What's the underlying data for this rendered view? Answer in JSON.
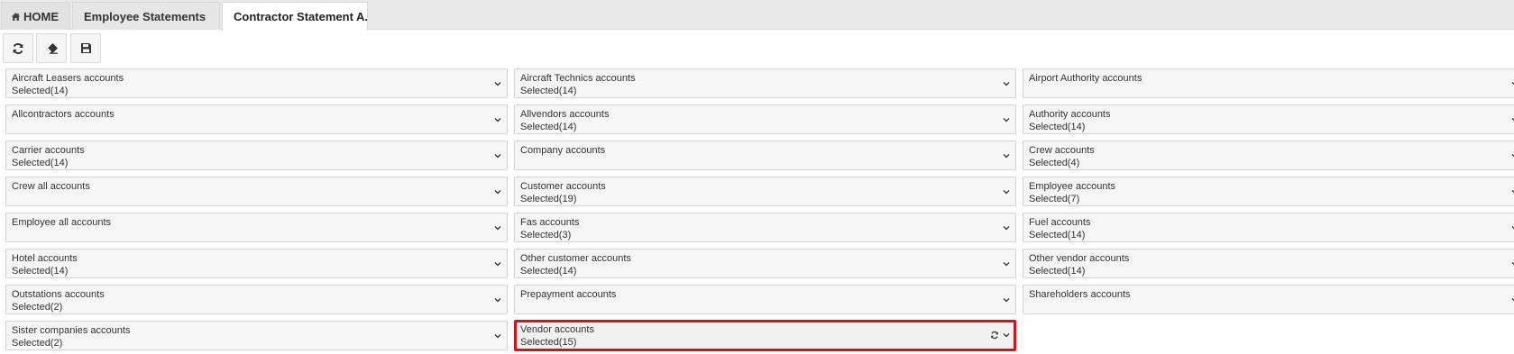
{
  "tabs": {
    "home": "HOME",
    "employee": "Employee Statements",
    "contractor": "Contractor Statement A..."
  },
  "fields": [
    {
      "label": "Aircraft Leasers accounts",
      "value": "Selected(14)"
    },
    {
      "label": "Aircraft Technics accounts",
      "value": "Selected(14)"
    },
    {
      "label": "Airport Authority accounts",
      "value": ""
    },
    {
      "label": "Allcontractors accounts",
      "value": ""
    },
    {
      "label": "Allvendors accounts",
      "value": "Selected(14)"
    },
    {
      "label": "Authority accounts",
      "value": "Selected(14)"
    },
    {
      "label": "Carrier accounts",
      "value": "Selected(14)"
    },
    {
      "label": "Company accounts",
      "value": ""
    },
    {
      "label": "Crew accounts",
      "value": "Selected(4)"
    },
    {
      "label": "Crew all accounts",
      "value": ""
    },
    {
      "label": "Customer accounts",
      "value": "Selected(19)"
    },
    {
      "label": "Employee accounts",
      "value": "Selected(7)"
    },
    {
      "label": "Employee all accounts",
      "value": ""
    },
    {
      "label": "Fas accounts",
      "value": "Selected(3)"
    },
    {
      "label": "Fuel accounts",
      "value": "Selected(14)"
    },
    {
      "label": "Hotel accounts",
      "value": "Selected(14)"
    },
    {
      "label": "Other customer accounts",
      "value": "Selected(14)"
    },
    {
      "label": "Other vendor accounts",
      "value": "Selected(14)"
    },
    {
      "label": "Outstations accounts",
      "value": "Selected(2)"
    },
    {
      "label": "Prepayment accounts",
      "value": ""
    },
    {
      "label": "Shareholders accounts",
      "value": ""
    },
    {
      "label": "Sister companies accounts",
      "value": "Selected(2)"
    },
    {
      "label": "Vendor accounts",
      "value": "Selected(15)"
    }
  ],
  "colors": {
    "highlight_border": "#d0161c",
    "field_bg": "#f6f6f6",
    "tabbar_bg": "#e9e9e9"
  },
  "icons": {
    "home": "home-icon",
    "refresh": "refresh-icon",
    "eraser": "eraser-icon",
    "save": "save-icon",
    "chevron": "chevron-down-icon"
  }
}
